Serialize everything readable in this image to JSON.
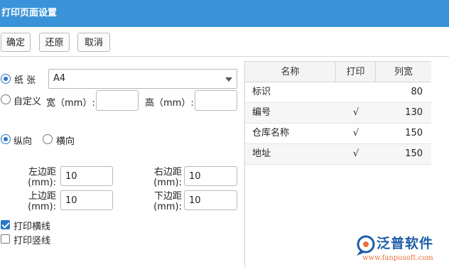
{
  "window": {
    "title": "打印页面设置"
  },
  "toolbar": {
    "confirm_label": "确定",
    "restore_label": "还原",
    "cancel_label": "取消"
  },
  "paper": {
    "paper_label": "纸 张",
    "paper_size": "A4",
    "custom_label": "自定义",
    "width_label": "宽（mm）:",
    "height_label": "高（mm）:",
    "width_value": "",
    "height_value": ""
  },
  "orientation": {
    "portrait_label": "纵向",
    "landscape_label": "横向",
    "selected": "portrait"
  },
  "margins": {
    "left_label": "左边距(mm):",
    "left_value": "10",
    "right_label": "右边距(mm):",
    "right_value": "10",
    "top_label": "上边距(mm):",
    "top_value": "10",
    "bottom_label": "下边距(mm):",
    "bottom_value": "10"
  },
  "options": {
    "print_hlines_label": "打印横线",
    "print_hlines": true,
    "print_vlines_label": "打印竖线",
    "print_vlines": false
  },
  "columns_table": {
    "headers": [
      "名称",
      "打印",
      "列宽"
    ],
    "rows": [
      {
        "name": "标识",
        "print": "",
        "width": "80"
      },
      {
        "name": "编号",
        "print": "√",
        "width": "130"
      },
      {
        "name": "仓库名称",
        "print": "√",
        "width": "150"
      },
      {
        "name": "地址",
        "print": "√",
        "width": "150"
      }
    ]
  },
  "watermark": {
    "brand": "泛普软件",
    "url": "www.fanpusoft.com",
    "brand_color": "#1e5ea8",
    "accent_color": "#e8743b"
  },
  "colors": {
    "titlebar": "#3a93d8",
    "accent": "#2b78c5"
  }
}
